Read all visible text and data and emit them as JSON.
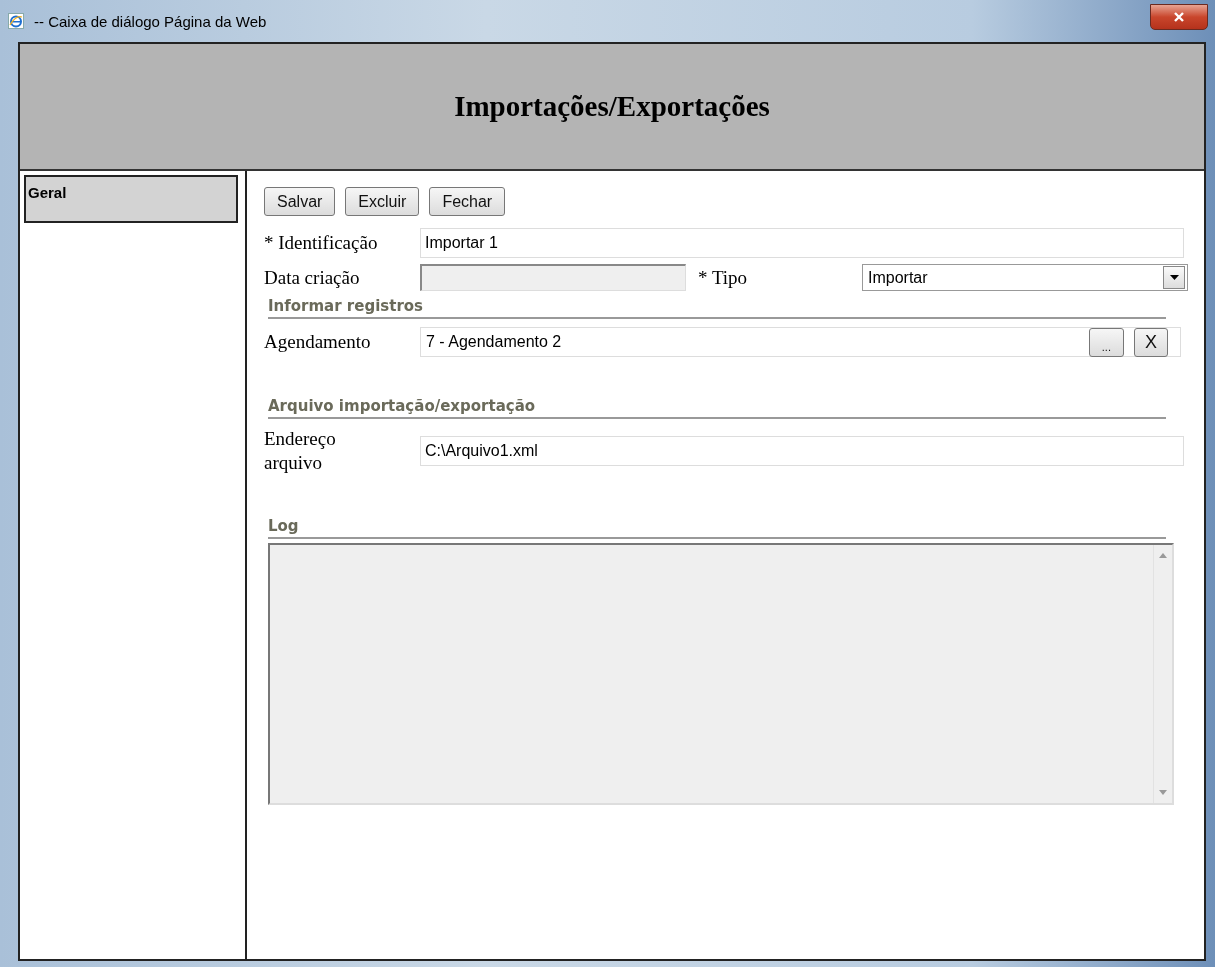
{
  "window": {
    "title": "-- Caixa de diálogo Página da Web"
  },
  "header": {
    "title": "Importações/Exportações"
  },
  "sidebar": {
    "items": [
      {
        "label": "Geral",
        "selected": true
      }
    ]
  },
  "toolbar": {
    "buttons": [
      "Salvar",
      "Excluir",
      "Fechar"
    ]
  },
  "form": {
    "identificacao": {
      "label": "* Identificação",
      "value": "Importar 1"
    },
    "data_criacao": {
      "label": "Data criação",
      "disabled": true
    },
    "tipo": {
      "label": "* Tipo",
      "value": "Importar"
    }
  },
  "sections": [
    {
      "title": "Informar registros",
      "kind": "lookup",
      "label": "Agendamento",
      "value": "7 - Agendamento 2",
      "buttons": [
        "...",
        "X"
      ]
    },
    {
      "title": "Arquivo importação/exportação",
      "kind": "text",
      "label": "Endereço arquivo",
      "value": "C:\\Arquivo1.xml"
    },
    {
      "title": "Log",
      "kind": "log"
    }
  ]
}
